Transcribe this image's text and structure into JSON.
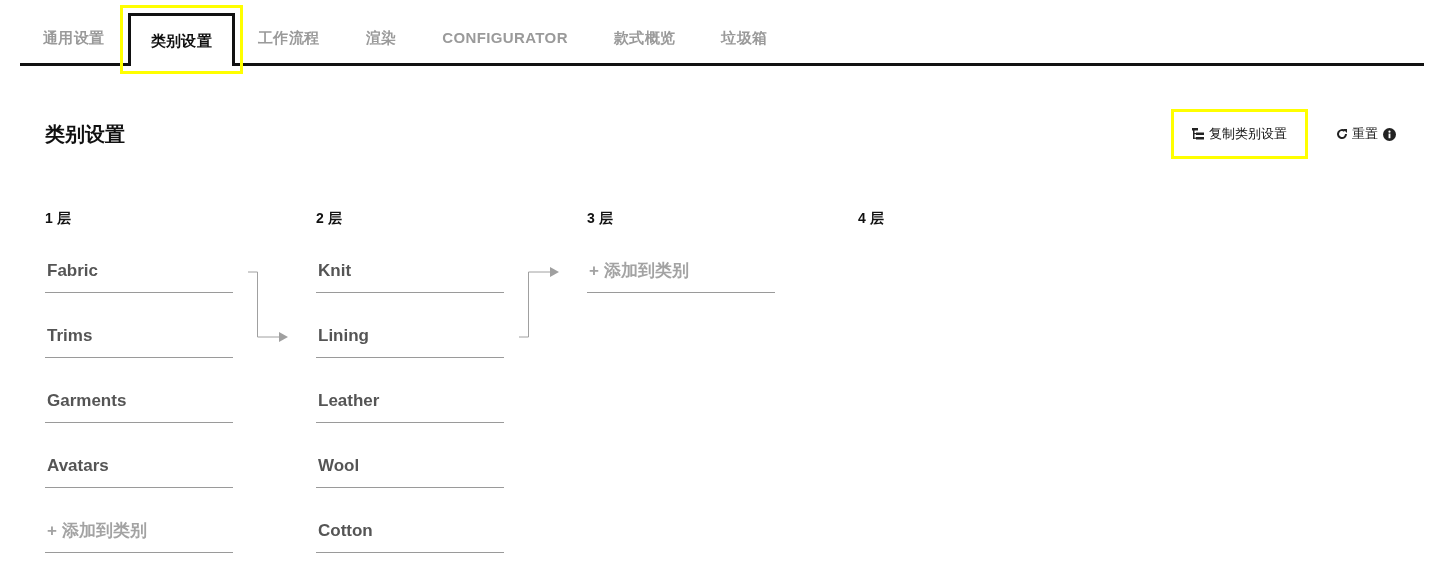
{
  "tabs": [
    {
      "label": "通用设置",
      "selected": false,
      "highlighted": false
    },
    {
      "label": "类别设置",
      "selected": true,
      "highlighted": true
    },
    {
      "label": "工作流程",
      "selected": false,
      "highlighted": false
    },
    {
      "label": "渲染",
      "selected": false,
      "highlighted": false
    },
    {
      "label": "CONFIGURATOR",
      "selected": false,
      "highlighted": false
    },
    {
      "label": "款式概览",
      "selected": false,
      "highlighted": false
    },
    {
      "label": "垃圾箱",
      "selected": false,
      "highlighted": false
    }
  ],
  "page_title": "类别设置",
  "actions": {
    "copy_button": {
      "label": "复制类别设置",
      "highlighted": true
    },
    "reset_button": {
      "label": "重置"
    }
  },
  "levels": [
    {
      "label": "1 层",
      "items": [
        {
          "kind": "item",
          "label": "Fabric",
          "expanded": true,
          "targeted": false
        },
        {
          "kind": "item",
          "label": "Trims",
          "expanded": false,
          "targeted": false
        },
        {
          "kind": "item",
          "label": "Garments",
          "expanded": false,
          "targeted": false
        },
        {
          "kind": "item",
          "label": "Avatars",
          "expanded": false,
          "targeted": false
        },
        {
          "kind": "add",
          "label": "+ 添加到类别",
          "expanded": false,
          "targeted": false
        }
      ]
    },
    {
      "label": "2 层",
      "items": [
        {
          "kind": "item",
          "label": "Knit",
          "expanded": false,
          "targeted": false
        },
        {
          "kind": "item",
          "label": "Lining",
          "expanded": true,
          "targeted": true
        },
        {
          "kind": "item",
          "label": "Leather",
          "expanded": false,
          "targeted": false
        },
        {
          "kind": "item",
          "label": "Wool",
          "expanded": false,
          "targeted": false
        },
        {
          "kind": "item",
          "label": "Cotton",
          "expanded": false,
          "targeted": false
        }
      ]
    },
    {
      "label": "3 层",
      "items": [
        {
          "kind": "add",
          "label": "+ 添加到类别",
          "expanded": false,
          "targeted": true
        }
      ]
    },
    {
      "label": "4 层"
    }
  ]
}
